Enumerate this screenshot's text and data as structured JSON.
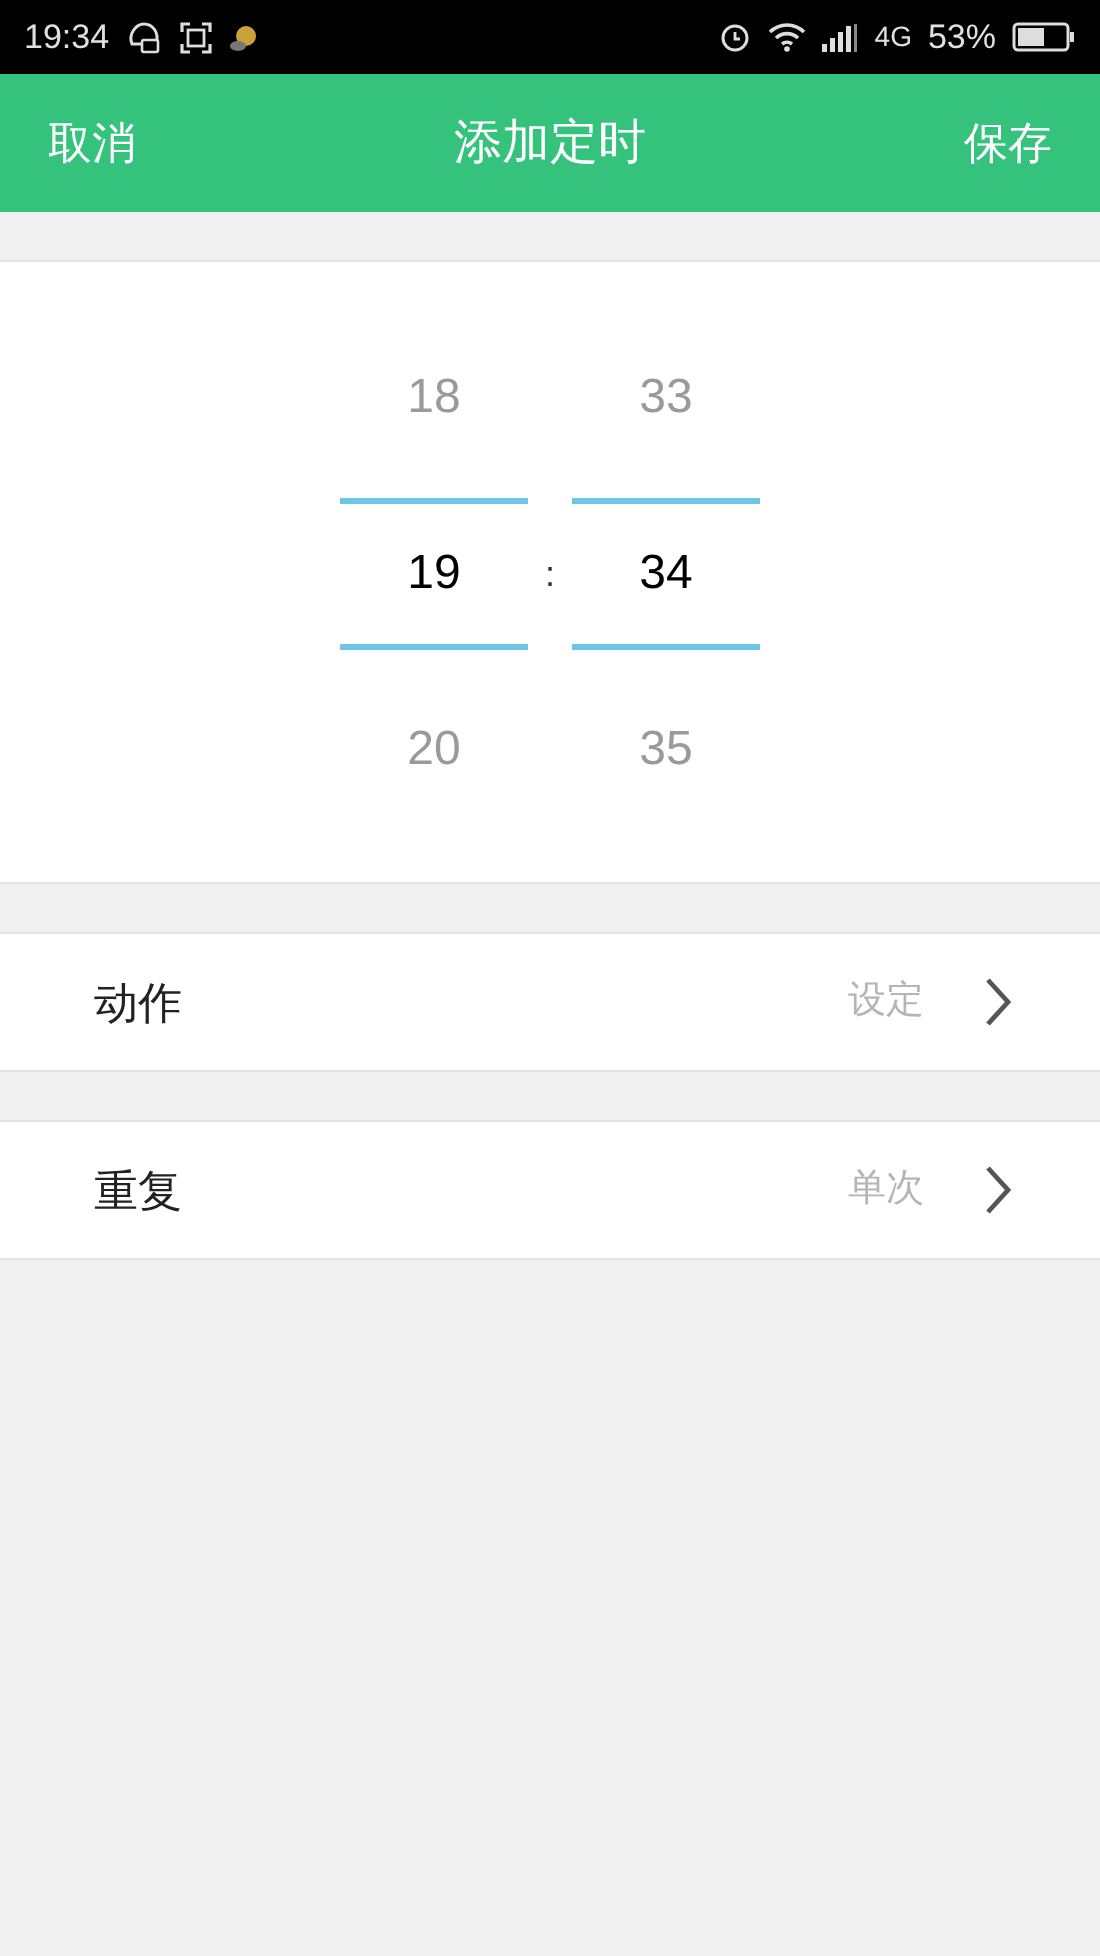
{
  "status_bar": {
    "time": "19:34",
    "network": "4G",
    "battery": "53%"
  },
  "header": {
    "cancel": "取消",
    "title": "添加定时",
    "save": "保存"
  },
  "picker": {
    "separator": ":",
    "columns": [
      {
        "items": [
          {
            "value": "18",
            "selected": false
          },
          {
            "value": "19",
            "selected": true
          },
          {
            "value": "20",
            "selected": false
          }
        ]
      },
      {
        "items": [
          {
            "value": "33",
            "selected": false
          },
          {
            "value": "34",
            "selected": true
          },
          {
            "value": "35",
            "selected": false
          }
        ]
      }
    ]
  },
  "settings": [
    {
      "label": "动作",
      "value": "设定"
    },
    {
      "label": "重复",
      "value": "单次"
    }
  ]
}
